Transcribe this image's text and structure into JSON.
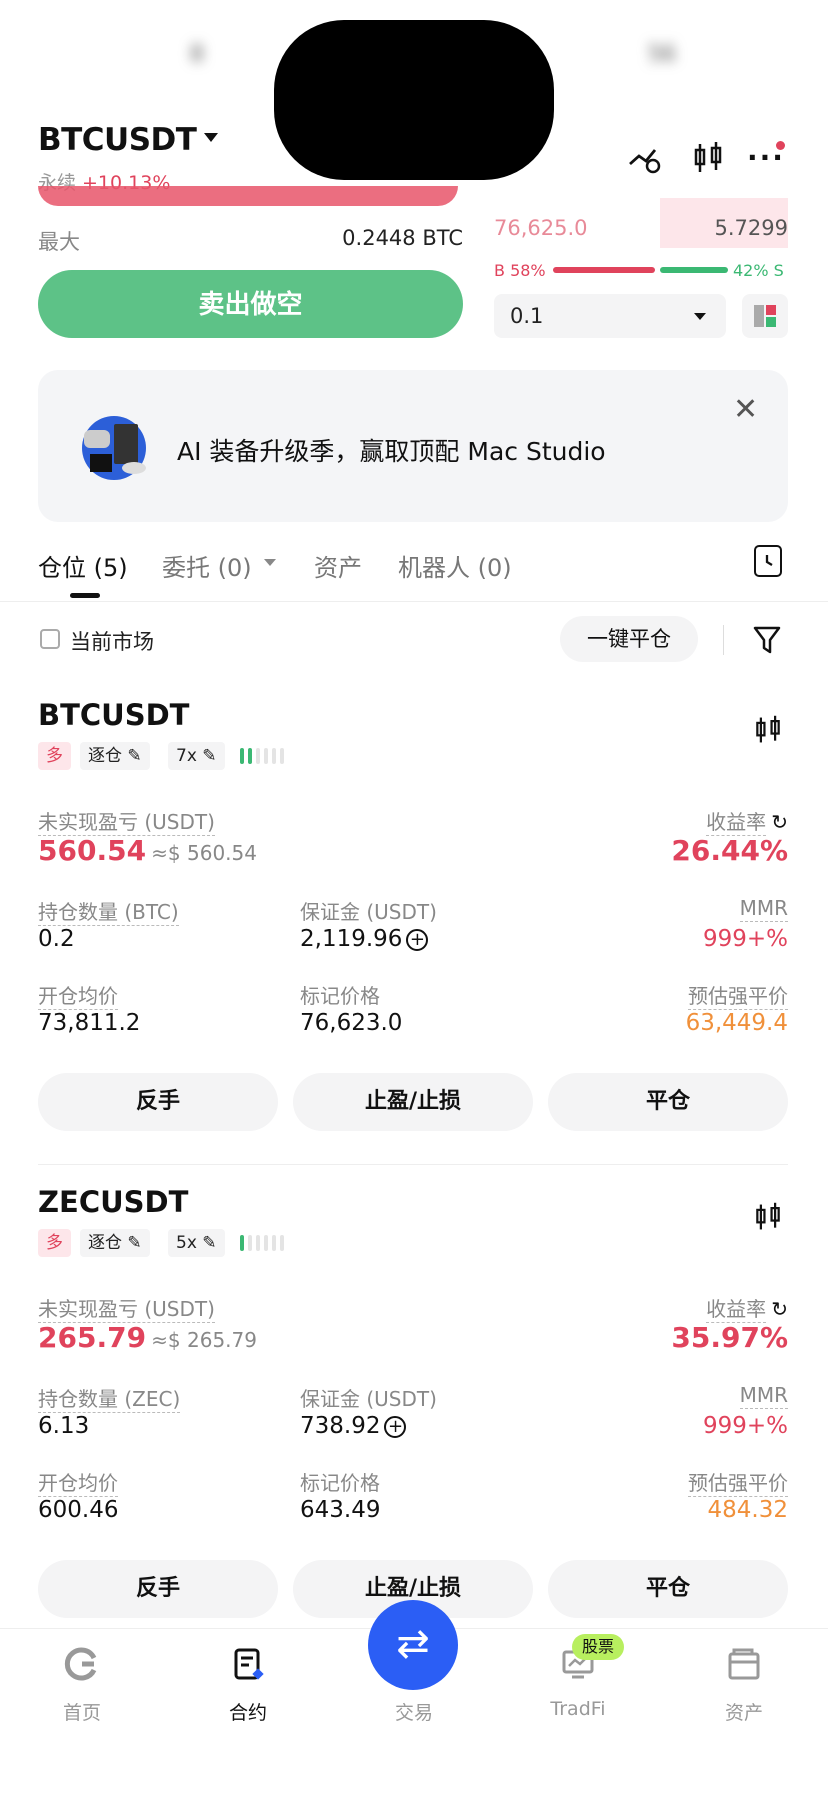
{
  "status_bar": {
    "time": "8",
    "battery": "56"
  },
  "header": {
    "symbol": "BTCUSDT",
    "contract_type": "永续",
    "change": "+10.13%"
  },
  "order_form": {
    "max_label": "最大",
    "max_value": "0.2448 BTC",
    "sell_button": "卖出做空",
    "book_price": "76,625.0",
    "book_qty": "5.7299",
    "buy_ratio": "B 58%",
    "sell_ratio": "42% S",
    "qty_value": "0.1"
  },
  "banner": {
    "text": "AI 装备升级季，赢取顶配 Mac Studio"
  },
  "tabs": [
    {
      "label": "仓位 (5)"
    },
    {
      "label": "委托 (0)"
    },
    {
      "label": "资产"
    },
    {
      "label": "机器人 (0)"
    }
  ],
  "filters": {
    "current_market": "当前市场",
    "close_all": "一键平仓"
  },
  "labels": {
    "unrealized_pnl": "未实现盈亏 (USDT)",
    "roi": "收益率",
    "margin": "保证金 (USDT)",
    "mmr": "MMR",
    "entry_price": "开仓均价",
    "mark_price": "标记价格",
    "liq_price": "预估强平价",
    "reverse": "反手",
    "tpsl": "止盈/止损",
    "close": "平仓"
  },
  "positions": [
    {
      "symbol": "BTCUSDT",
      "side": "多",
      "margin_mode": "逐仓",
      "leverage": "7x",
      "pnl": "560.54",
      "pnl_usd": "≈$ 560.54",
      "roi": "26.44%",
      "size_label": "持仓数量 (BTC)",
      "size": "0.2",
      "margin": "2,119.96",
      "mmr": "999+%",
      "entry": "73,811.2",
      "mark": "76,623.0",
      "liq": "63,449.4"
    },
    {
      "symbol": "ZECUSDT",
      "side": "多",
      "margin_mode": "逐仓",
      "leverage": "5x",
      "pnl": "265.79",
      "pnl_usd": "≈$ 265.79",
      "roi": "35.97%",
      "size_label": "持仓数量 (ZEC)",
      "size": "6.13",
      "margin": "738.92",
      "mmr": "999+%",
      "entry": "600.46",
      "mark": "643.49",
      "liq": "484.32"
    }
  ],
  "nav": [
    {
      "label": "首页",
      "icon": "home-icon"
    },
    {
      "label": "合约",
      "icon": "contract-icon"
    },
    {
      "label": "交易",
      "icon": "swap-icon"
    },
    {
      "label": "TradFi",
      "icon": "tradfi-icon",
      "badge": "股票"
    },
    {
      "label": "资产",
      "icon": "wallet-icon"
    }
  ],
  "colors": {
    "accent_red": "#e0435c",
    "accent_green": "#5dc287",
    "fab_blue": "#2b5ef5",
    "liq_orange": "#f0903a"
  }
}
